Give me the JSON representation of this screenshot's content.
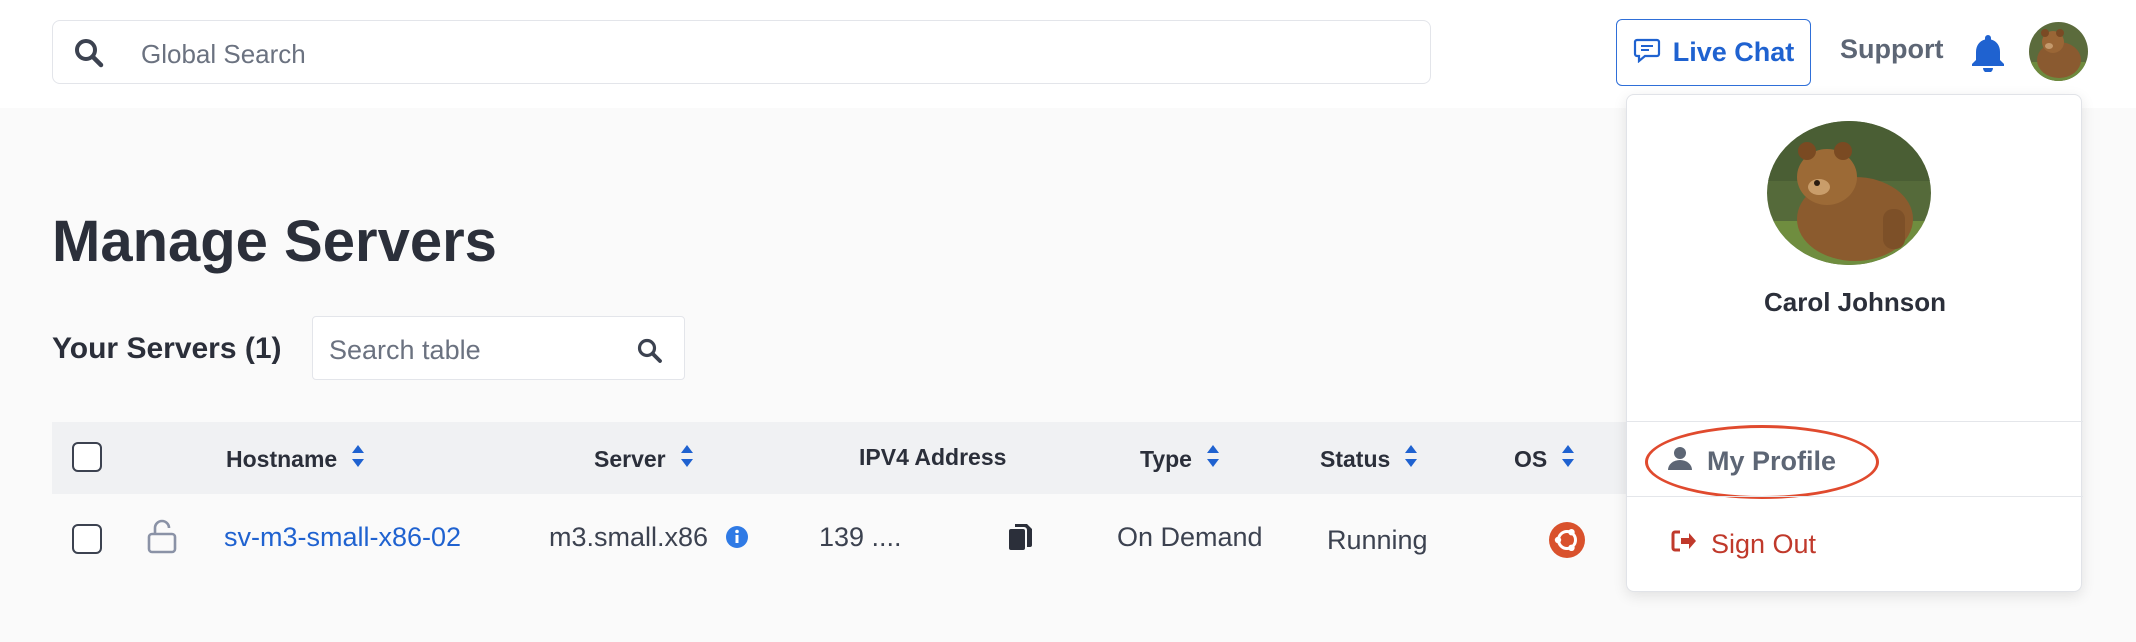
{
  "header": {
    "search_placeholder": "Global Search",
    "live_chat_label": "Live Chat",
    "support_label": "Support"
  },
  "page": {
    "title": "Manage Servers",
    "servers_count_label": "Your Servers (1)",
    "table_search_placeholder": "Search table"
  },
  "table": {
    "columns": {
      "hostname": "Hostname",
      "server": "Server",
      "ipv4": "IPV4 Address",
      "type": "Type",
      "status": "Status",
      "os": "OS"
    },
    "rows": [
      {
        "hostname": "sv-m3-small-x86-02",
        "server": "m3.small.x86",
        "ipv4": "139 ....",
        "type": "On Demand",
        "status": "Running",
        "os_icon": "ubuntu-icon"
      }
    ]
  },
  "user_menu": {
    "name": "Carol Johnson",
    "items": [
      {
        "label": "My Profile",
        "icon": "user-icon"
      },
      {
        "label": "Sign Out",
        "icon": "sign-out-icon"
      }
    ]
  },
  "colors": {
    "accent": "#1f62d0",
    "danger": "#c0392b",
    "highlight": "#e04a2e",
    "ubuntu": "#d9512c"
  }
}
